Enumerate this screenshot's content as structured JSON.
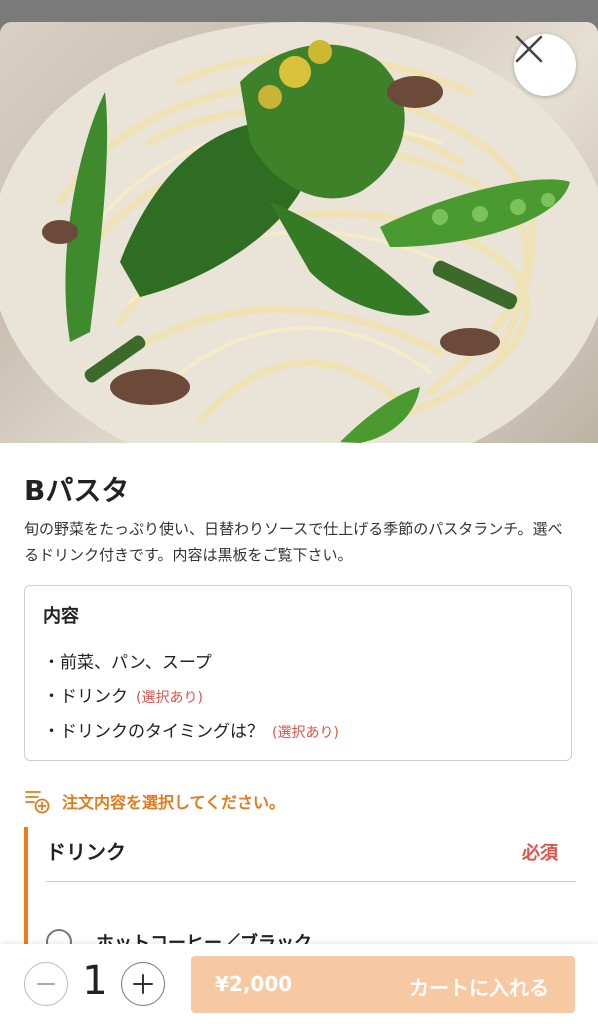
{
  "item": {
    "title": "Bパスタ",
    "description": "旬の野菜をたっぷり使い、日替わりソースで仕上げる季節のパスタランチ。選べるドリンク付きです。内容は黒板をご覧下さい。"
  },
  "contents": {
    "title": "内容",
    "items": [
      {
        "text": "・前菜、パン、スープ",
        "note": ""
      },
      {
        "text": "・ドリンク",
        "note": "(選択あり)"
      },
      {
        "text": "・ドリンクのタイミングは？",
        "note": "(選択あり)"
      }
    ]
  },
  "notice": "注文内容を選択してください。",
  "option_group": {
    "title": "ドリンク",
    "required_label": "必須",
    "options": [
      {
        "label": "ホットコーヒー／ブラック",
        "selected": false
      }
    ]
  },
  "cart": {
    "quantity": "1",
    "price": "¥2,000",
    "add_label": "カートに入れる"
  },
  "icons": {
    "close": "close-icon",
    "notice": "list-add-icon",
    "minus": "minus-icon",
    "plus": "plus-icon"
  },
  "colors": {
    "accent": "#ef7d17",
    "required": "#e0534a",
    "cart_button": "#f7c9a2"
  }
}
